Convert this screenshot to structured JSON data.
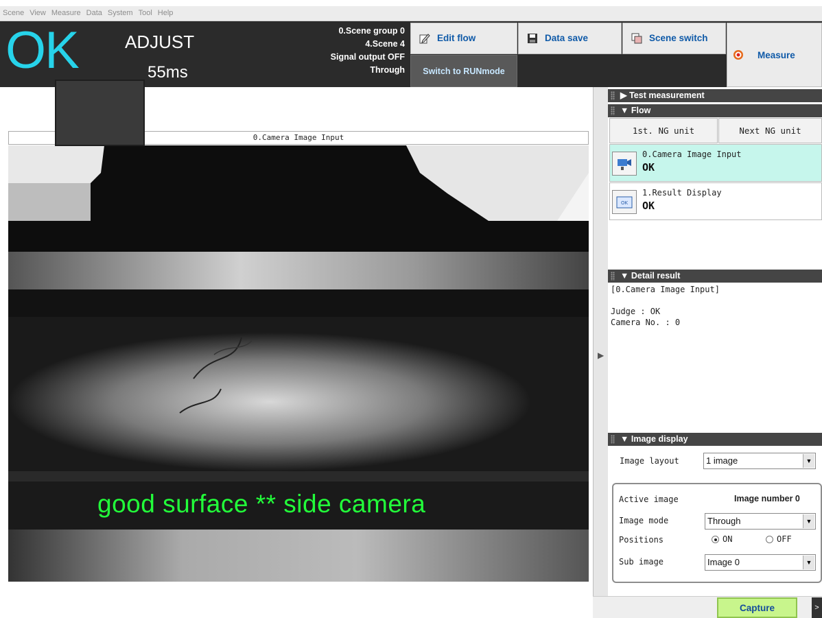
{
  "menu": [
    "Scene",
    "View",
    "Measure",
    "Data",
    "System",
    "Tool",
    "Help"
  ],
  "header": {
    "judge": "OK",
    "mode": "ADJUST",
    "time": "55ms",
    "status": [
      "0.Scene group 0",
      "4.Scene 4",
      "Signal output OFF",
      "Through"
    ],
    "buttons": {
      "edit_flow": "Edit flow",
      "data_save": "Data save",
      "scene_switch": "Scene switch",
      "measure": "Measure",
      "run_mode": "Switch to RUNmode"
    }
  },
  "image_panel": {
    "title": "0.Camera Image Input",
    "caption": "good surface ** side camera"
  },
  "right_panel": {
    "test_measurement": "Test measurement",
    "flow_header": "Flow",
    "first_ng": "1st. NG unit",
    "next_ng": "Next NG unit",
    "flow_items": [
      {
        "name": "0.Camera Image Input",
        "result": "OK"
      },
      {
        "name": "1.Result Display",
        "result": "OK"
      }
    ],
    "detail_header": "Detail result",
    "detail_lines": [
      "[0.Camera Image Input]",
      "",
      "Judge : OK",
      "Camera No. : 0"
    ],
    "image_display_header": "Image display",
    "image_layout_label": "Image layout",
    "image_layout_value": "1 image",
    "active_image_label": "Active image",
    "active_image_value": "Image number 0",
    "image_mode_label": "Image mode",
    "image_mode_value": "Through",
    "positions_label": "Positions",
    "positions_on": "ON",
    "positions_off": "OFF",
    "sub_image_label": "Sub image",
    "sub_image_value": "Image 0",
    "capture": "Capture"
  },
  "colors": {
    "ok_color": "#27d3ea",
    "caption_color": "#22ff3a",
    "button_text": "#0f5aa8",
    "capture_bg": "#c8f58c"
  }
}
